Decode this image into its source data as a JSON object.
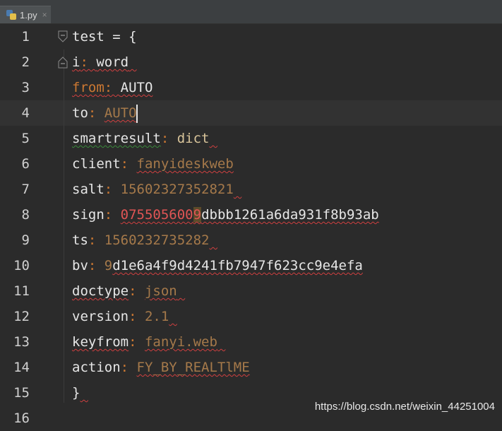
{
  "tab": {
    "filename": "1.py",
    "close": "×"
  },
  "lines": [
    {
      "num": "1",
      "key": "test",
      "sep": " = ",
      "value": "{"
    },
    {
      "num": "2",
      "key": "i",
      "sep": ": ",
      "value": "word"
    },
    {
      "num": "3",
      "key": "from",
      "sep": ": ",
      "value": "AUTO"
    },
    {
      "num": "4",
      "key": "to",
      "sep": ": ",
      "value": "AUTO"
    },
    {
      "num": "5",
      "key": "smartresult",
      "sep": ": ",
      "value": "dict"
    },
    {
      "num": "6",
      "key": "client",
      "sep": ": ",
      "value": "fanyideskweb"
    },
    {
      "num": "7",
      "key": "salt",
      "sep": ": ",
      "value": "15602327352821"
    },
    {
      "num": "8",
      "key": "sign",
      "sep": ": ",
      "value_a": "075505600",
      "value_b": "9",
      "value_c": "dbbb1261a6da931f8b93ab"
    },
    {
      "num": "9",
      "key": "ts",
      "sep": ": ",
      "value": "1560232735282"
    },
    {
      "num": "10",
      "key": "bv",
      "sep": ": ",
      "value_a": "9",
      "value_b": "d1e6a4f9d4241fb7947f623cc9e4efa"
    },
    {
      "num": "11",
      "key": "doctype",
      "sep": ": ",
      "value": "json"
    },
    {
      "num": "12",
      "key": "version",
      "sep": ": ",
      "value": "2.1"
    },
    {
      "num": "13",
      "key": "keyfrom",
      "sep": ": ",
      "value": "fanyi.web"
    },
    {
      "num": "14",
      "key": "action",
      "sep": ": ",
      "value": "FY_BY_REALTlME"
    },
    {
      "num": "15",
      "key": "",
      "sep": "",
      "value": "}"
    },
    {
      "num": "16",
      "key": "",
      "sep": "",
      "value": ""
    }
  ],
  "watermark": "https://blog.csdn.net/weixin_44251004",
  "colors": {
    "background": "#2b2b2b",
    "current_line": "#323232",
    "value": "#a5794a",
    "error": "#e05555"
  }
}
